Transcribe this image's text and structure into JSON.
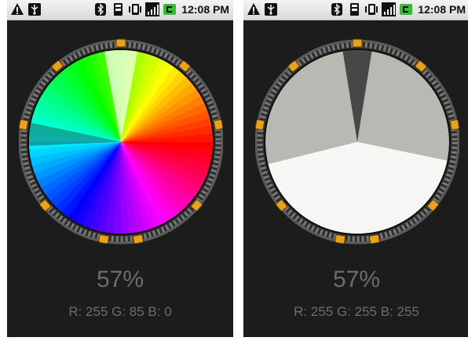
{
  "screens": [
    {
      "status_bar": {
        "icons_left": [
          "warning-icon",
          "usb-icon"
        ],
        "icons_right": [
          "bluetooth-icon",
          "sd-card-icon",
          "vibrate-icon",
          "signal-icon",
          "battery-charging-icon"
        ],
        "time": "12:08 PM"
      },
      "percent": "57%",
      "rgb_readout": "R: 255 G: 85 B: 0",
      "wheel_mode": "color-wheel"
    },
    {
      "status_bar": {
        "icons_left": [
          "warning-icon",
          "usb-icon"
        ],
        "icons_right": [
          "bluetooth-icon",
          "sd-card-icon",
          "vibrate-icon",
          "signal-icon",
          "battery-charging-icon"
        ],
        "time": "12:08 PM"
      },
      "percent": "57%",
      "rgb_readout": "R: 255 G: 255 B: 255",
      "wheel_mode": "grayscale-sectors"
    }
  ],
  "colors": {
    "background": "#1c1c1c",
    "text": "#6d6d6d",
    "ring_chevron": "#e8a11a",
    "sector_gray": "#b6bab3",
    "sector_white": "#f6f6f4",
    "sector_dark": "#474747"
  }
}
